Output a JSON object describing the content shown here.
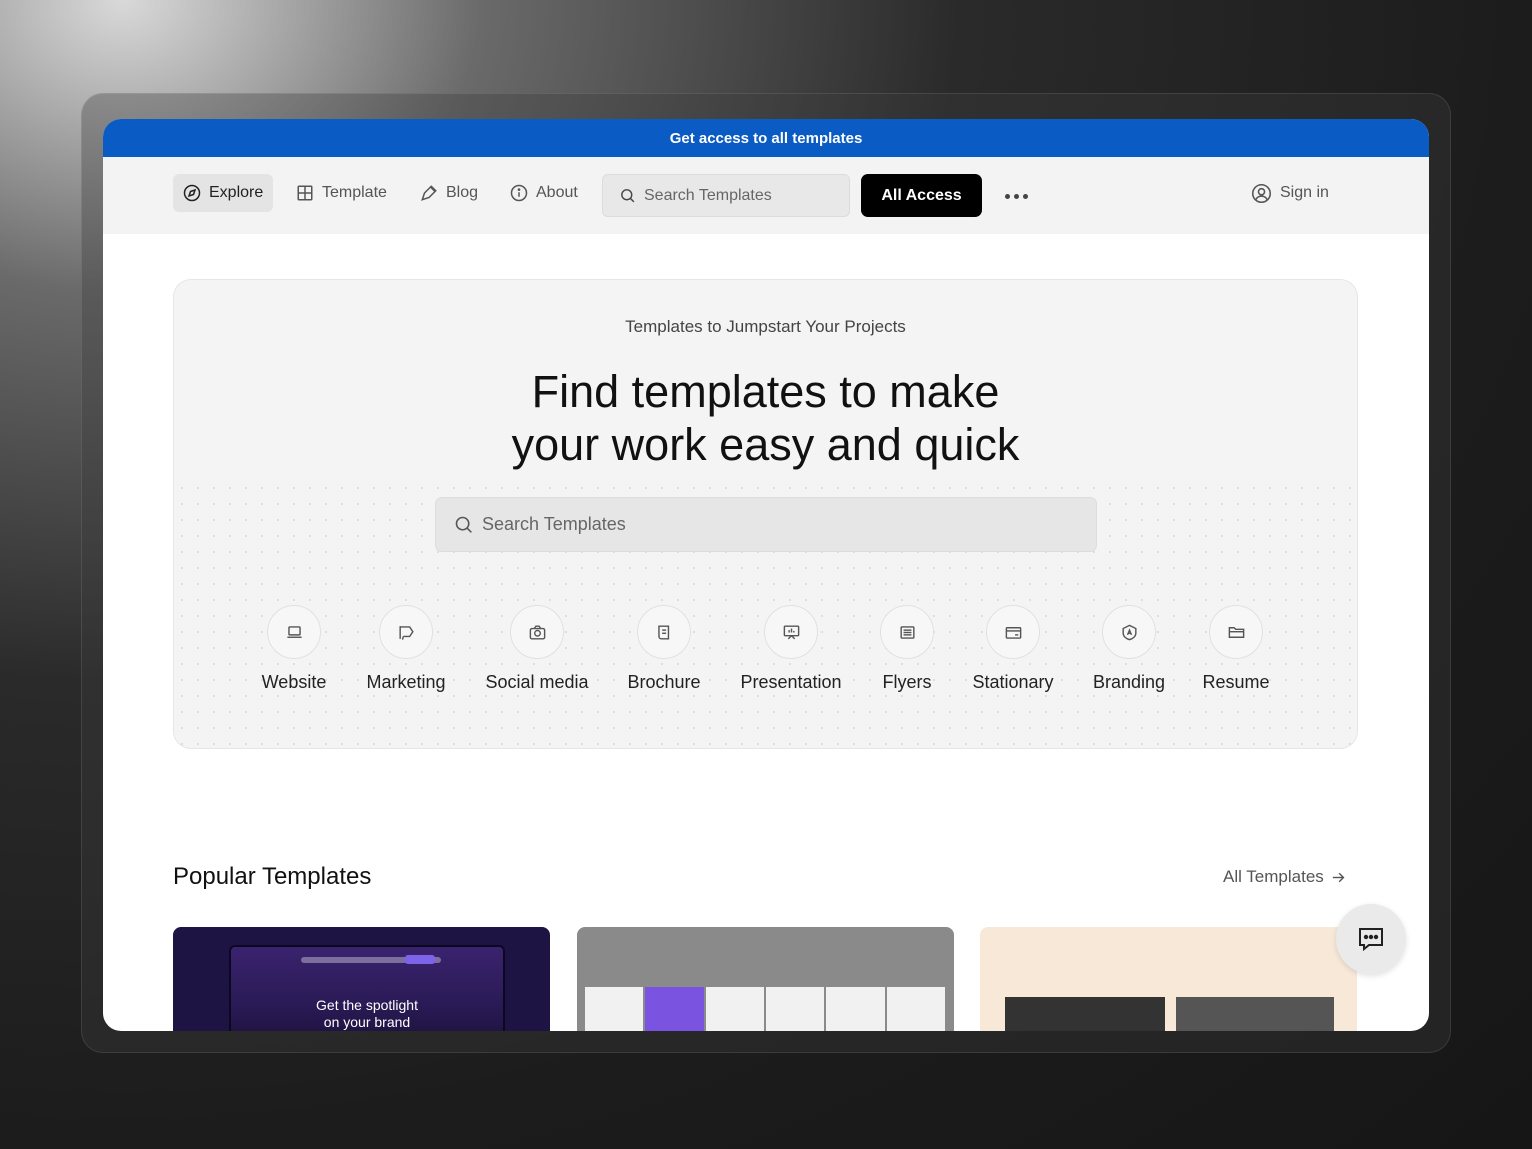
{
  "promo": {
    "text": "Get access to all templates"
  },
  "nav": {
    "items": [
      {
        "label": "Explore",
        "icon": "compass-icon",
        "active": true
      },
      {
        "label": "Template",
        "icon": "grid-icon"
      },
      {
        "label": "Blog",
        "icon": "pen-icon"
      },
      {
        "label": "About",
        "icon": "info-icon"
      }
    ],
    "search_placeholder": "Search Templates",
    "cta_label": "All Access",
    "more_icon": "more-dots-icon",
    "sign_in_label": "Sign in"
  },
  "hero": {
    "subtitle": "Templates to Jumpstart Your Projects",
    "title_line1": "Find templates to make",
    "title_line2": "your work easy and quick",
    "search_placeholder": "Search Templates",
    "categories": [
      {
        "label": "Website",
        "icon": "laptop-icon"
      },
      {
        "label": "Marketing",
        "icon": "megaphone-icon"
      },
      {
        "label": "Social media",
        "icon": "camera-icon"
      },
      {
        "label": "Brochure",
        "icon": "brochure-icon"
      },
      {
        "label": "Presentation",
        "icon": "presentation-icon"
      },
      {
        "label": "Flyers",
        "icon": "flyer-icon"
      },
      {
        "label": "Stationary",
        "icon": "card-icon"
      },
      {
        "label": "Branding",
        "icon": "badge-icon"
      },
      {
        "label": "Resume",
        "icon": "folder-icon"
      }
    ]
  },
  "popular": {
    "title": "Popular Templates",
    "all_link": "All Templates",
    "cards": [
      {
        "headline_1": "Get the spotlight",
        "headline_2": "on your brand"
      },
      {},
      {}
    ]
  },
  "colors": {
    "promo_bg": "#0b5bc4",
    "cta_bg": "#000000",
    "card1_bg": "#1e1444",
    "card3_bg": "#f8e8d8"
  }
}
